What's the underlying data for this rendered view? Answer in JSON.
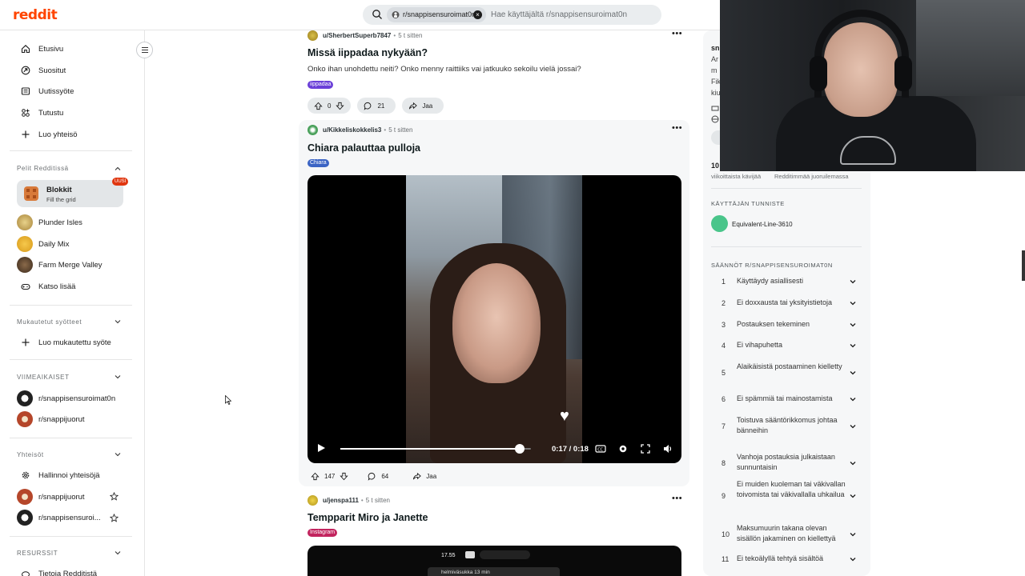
{
  "header": {
    "logo": "reddit",
    "search_chip": "r/snappisensuroimat0n",
    "search_placeholder": "Hae käyttäjältä r/snappisensuroimat0n"
  },
  "sidebar": {
    "nav": [
      {
        "label": "Etusivu",
        "icon": "home-icon"
      },
      {
        "label": "Suositut",
        "icon": "popular-icon"
      },
      {
        "label": "Uutissyöte",
        "icon": "news-icon"
      },
      {
        "label": "Tutustu",
        "icon": "explore-icon"
      },
      {
        "label": "Luo yhteisö",
        "icon": "plus-icon"
      }
    ],
    "games_heading": "Pelit Redditissä",
    "featured_game": {
      "title": "Blokkit",
      "subtitle": "Fill the grid",
      "badge": "UUSI"
    },
    "games": [
      {
        "label": "Plunder Isles"
      },
      {
        "label": "Daily Mix"
      },
      {
        "label": "Farm Merge Valley"
      },
      {
        "label": "Katso lisää"
      }
    ],
    "custom_heading": "Mukautetut syötteet",
    "custom_create": "Luo mukautettu syöte",
    "recent_heading": "VIIMEAIKAISET",
    "recent": [
      {
        "label": "r/snappisensuroimat0n"
      },
      {
        "label": "r/snappijuorut"
      }
    ],
    "communities_heading": "Yhteisöt",
    "communities_manage": "Hallinnoi yhteisöjä",
    "communities": [
      {
        "label": "r/snappijuorut"
      },
      {
        "label": "r/snappisensuroi..."
      }
    ],
    "resources_heading": "RESURSSIT",
    "resources_first": "Tietoja Redditistä"
  },
  "posts": [
    {
      "user": "u/SherbertSuperb7847",
      "time": "5 t sitten",
      "title": "Missä iippadaa nykyään?",
      "body": "Onko ihan unohdettu neiti? Onko menny raittiiks vai jatkuuko sekoilu vielä jossai?",
      "flair": "iippadaa",
      "flair_color": "#6a3fd8",
      "score": "0",
      "comments": "21",
      "share": "Jaa"
    },
    {
      "user": "u/Kikkeliskokkelis3",
      "time": "5 t sitten",
      "title": "Chiara palauttaa pulloja",
      "flair": "Chiara",
      "flair_color": "#3b64c4",
      "video_time": "0:17 / 0:18",
      "video_progress": 0.94,
      "score": "147",
      "comments": "64",
      "share": "Jaa"
    },
    {
      "user": "u/jenspa111",
      "time": "5 t sitten",
      "title": "Tempparit Miro ja Janette",
      "flair": "Instagram",
      "flair_color": "#c2245e",
      "screen_time": "17.55",
      "notif_text": "helmiväsukka  13 min"
    }
  ],
  "right": {
    "title_fragment": "sn",
    "lines": [
      "Ar",
      "m",
      "Fik",
      "kiu"
    ],
    "stat_value": "10",
    "stat_label_1": "viikoittaista kävijää",
    "stat_label_2": "Redditimmää juoruilemassa",
    "flair_heading": "KÄYTTÄJÄN TUNNISTE",
    "flair_user": "Equivalent-Line-3610",
    "rules_heading": "SÄÄNNÖT R/SNAPPISENSUROIMAT0N",
    "rules": [
      {
        "n": "1",
        "t": "Käyttäydy asiallisesti"
      },
      {
        "n": "2",
        "t": "Ei doxxausta tai yksityistietoja"
      },
      {
        "n": "3",
        "t": "Postauksen tekeminen"
      },
      {
        "n": "4",
        "t": "Ei vihapuhetta"
      },
      {
        "n": "5",
        "t": "Alaikäisistä postaaminen kielletty"
      },
      {
        "n": "6",
        "t": "Ei spämmiä tai mainostamista"
      },
      {
        "n": "7",
        "t": "Toistuva sääntörikkomus johtaa bänneihin"
      },
      {
        "n": "8",
        "t": "Vanhoja postauksia julkaistaan sunnuntaisin"
      },
      {
        "n": "9",
        "t": "Ei muiden kuoleman tai väkivallan toivomista tai väkivallalla uhkailua"
      },
      {
        "n": "10",
        "t": "Maksumuurin takana olevan sisällön jakaminen on kiellettyä"
      },
      {
        "n": "11",
        "t": "Ei tekoälyllä tehtyä sisältöä"
      }
    ]
  },
  "colors": {
    "brand": "#ff4500",
    "sidebar_bg": "#f6f7f8"
  }
}
